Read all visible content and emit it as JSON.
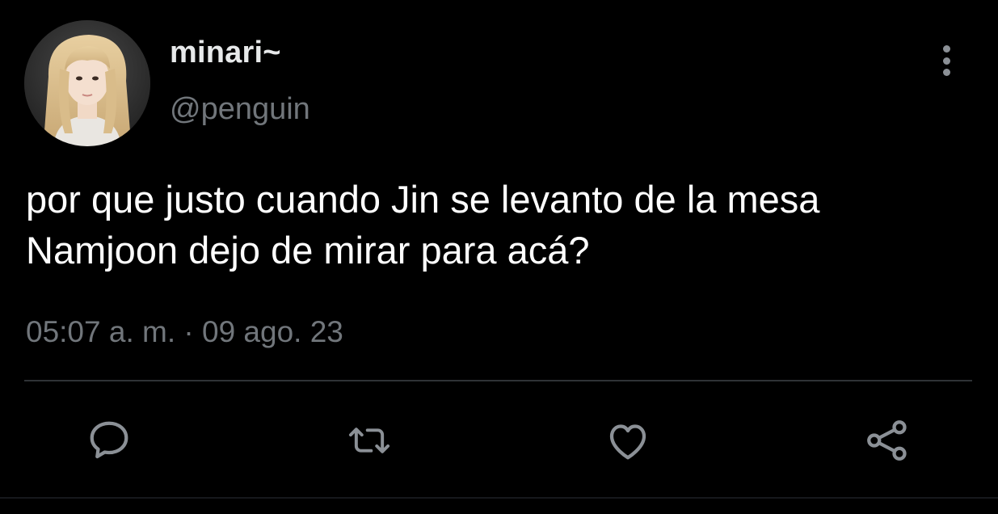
{
  "tweet": {
    "display_name": "minari~",
    "handle": "@penguin",
    "text": "por que justo cuando Jin se levanto de la mesa Namjoon dejo de mirar para acá?",
    "timestamp": "05:07 a. m. · 09 ago. 23"
  },
  "actions": [
    {
      "name": "reply",
      "icon": "speech-bubble-icon"
    },
    {
      "name": "retweet",
      "icon": "retweet-icon"
    },
    {
      "name": "like",
      "icon": "heart-icon"
    },
    {
      "name": "share",
      "icon": "share-icon"
    }
  ],
  "colors": {
    "background": "#000000",
    "primary_text": "#e7e9ea",
    "secondary_text": "#71767b",
    "divider": "#2f3336"
  }
}
